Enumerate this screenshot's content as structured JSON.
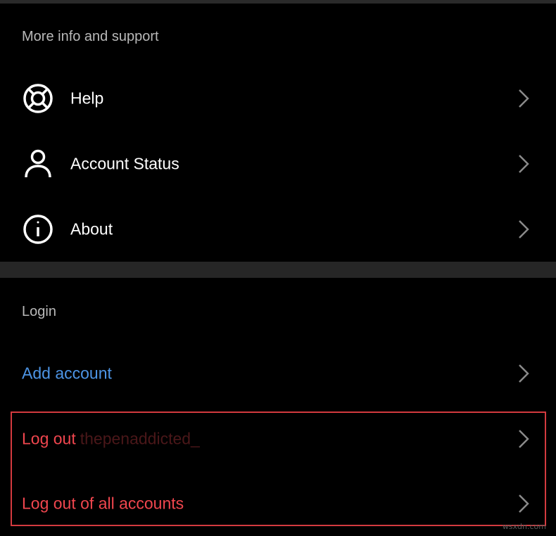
{
  "sections": {
    "support": {
      "header": "More info and support",
      "items": [
        {
          "label": "Help",
          "icon": "lifebuoy-icon"
        },
        {
          "label": "Account Status",
          "icon": "person-icon"
        },
        {
          "label": "About",
          "icon": "info-icon"
        }
      ]
    },
    "login": {
      "header": "Login",
      "add_account": "Add account",
      "logout_prefix": "Log out",
      "logout_username": "thepenaddicted_",
      "logout_all": "Log out of all accounts"
    }
  },
  "watermark": "wsxdn.com",
  "colors": {
    "background": "#000000",
    "link_blue": "#4d95e6",
    "danger_red": "#f0464e",
    "highlight_border": "#d33a3f",
    "divider": "#262626"
  }
}
